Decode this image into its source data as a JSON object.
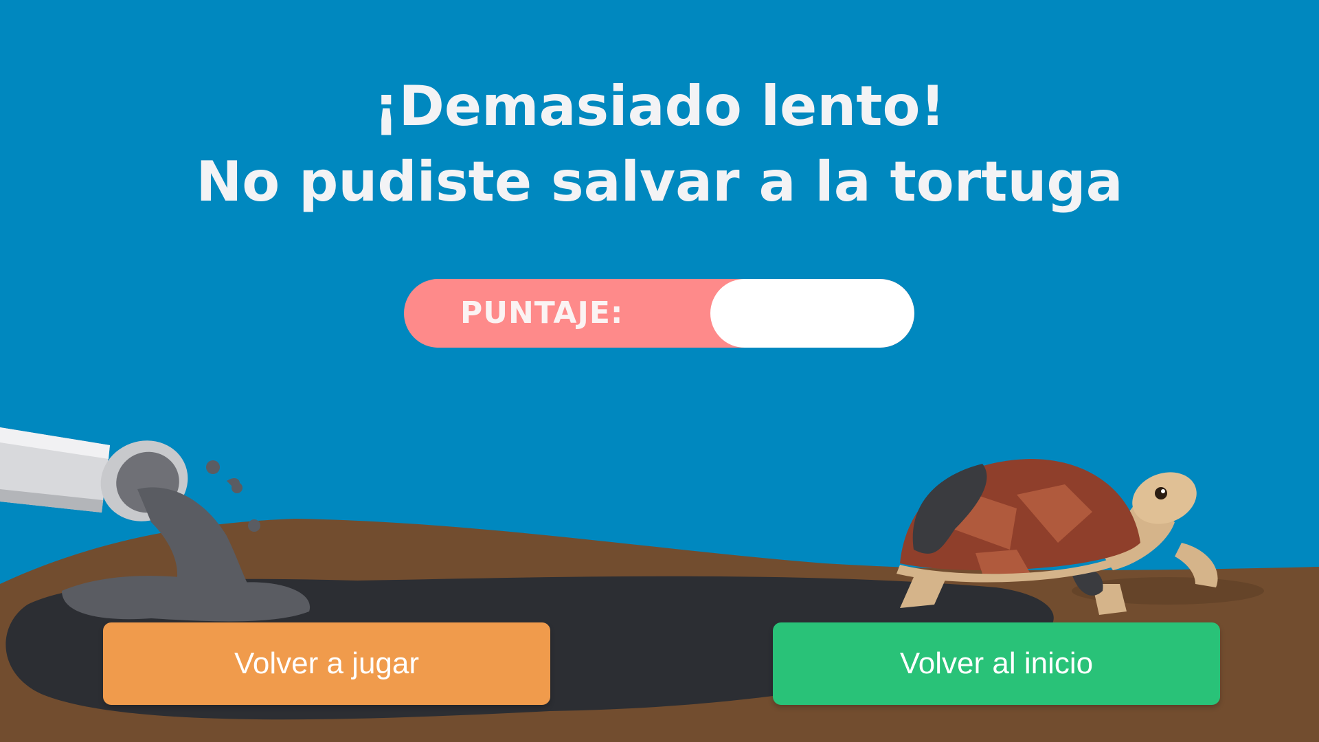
{
  "title": {
    "line1": "¡Demasiado lento!",
    "line2": "No pudiste salvar a la tortuga"
  },
  "score": {
    "label": "PUNTAJE:",
    "value": ""
  },
  "buttons": {
    "replay_label": "Volver a jugar",
    "home_label": "Volver al inicio"
  },
  "colors": {
    "background": "#0088bf",
    "score_badge": "#fe8a8a",
    "replay_button": "#f09b4c",
    "home_button": "#29c278",
    "ground": "#724d2f",
    "oil": "#2c2e33"
  },
  "scene": {
    "pipe": "pipe-icon",
    "oil_spill": "oil-spill",
    "turtle": "turtle-icon"
  }
}
